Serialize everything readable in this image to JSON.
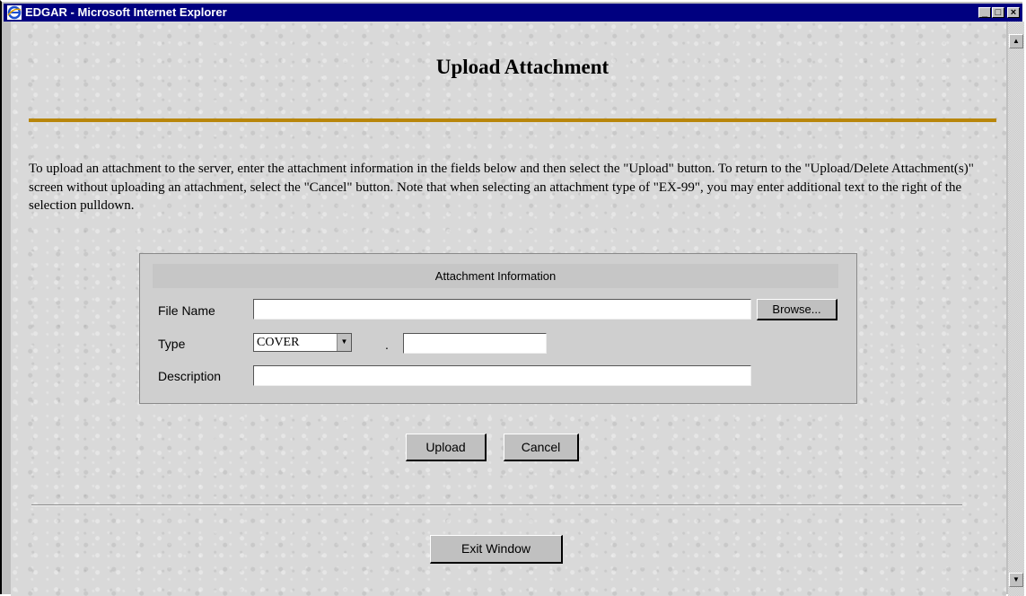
{
  "window": {
    "title": "EDGAR - Microsoft Internet Explorer",
    "minimize": "_",
    "maximize": "□",
    "close": "×"
  },
  "page": {
    "title": "Upload Attachment",
    "instructions": "To upload an attachment to the server, enter the attachment information in the fields below and then select the \"Upload\" button. To return to the \"Upload/Delete Attachment(s)\" screen without uploading an attachment, select the \"Cancel\" button. Note that when selecting an attachment type of \"EX-99\", you may enter additional text to the right of the selection pulldown."
  },
  "form": {
    "header": "Attachment Information",
    "file_name_label": "File Name",
    "file_name_value": "",
    "browse_label": "Browse...",
    "type_label": "Type",
    "type_selected": "COVER",
    "type_separator": ".",
    "type_extra_value": "",
    "description_label": "Description",
    "description_value": ""
  },
  "actions": {
    "upload_label": "Upload",
    "cancel_label": "Cancel",
    "exit_label": "Exit Window"
  },
  "colors": {
    "titlebar": "#000080",
    "rule": "#b8860b"
  }
}
